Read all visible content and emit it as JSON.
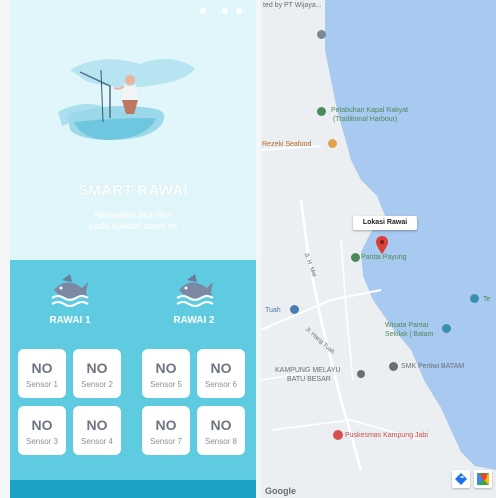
{
  "colors": {
    "left_top_bg": "#e1f6fb",
    "left_bottom_bg": "#5fcbe0",
    "nav_bar": "#1aa3c5",
    "card_bg": "#ffffff",
    "map_land": "#eceff1",
    "map_water": "#a8c9f0"
  },
  "app": {
    "title": "SMART RAWAI",
    "subtitle_line1": "Nikmatilah fitur-fitur",
    "subtitle_line2": "pada aplikasi rawai ini",
    "rawai1": {
      "label": "RAWAI 1",
      "sensors": [
        {
          "value": "NO",
          "label": "Sensor 1"
        },
        {
          "value": "NO",
          "label": "Sensor 2"
        },
        {
          "value": "NO",
          "label": "Sensor 3"
        },
        {
          "value": "NO",
          "label": "Sensor 4"
        }
      ]
    },
    "rawai2": {
      "label": "RAWAI 2",
      "sensors": [
        {
          "value": "NO",
          "label": "Sensor 5"
        },
        {
          "value": "NO",
          "label": "Sensor 6"
        },
        {
          "value": "NO",
          "label": "Sensor 7"
        },
        {
          "value": "NO",
          "label": "Sensor 8"
        }
      ]
    },
    "icons": {
      "hero": "fisherman-boat-illustration",
      "rawai": "fish-wave-icon"
    }
  },
  "map": {
    "labels": {
      "top_attribution": "ted by PT Wijaya...",
      "pelabuhan_line1": "Pelabuhan Kapal Rakyat",
      "pelabuhan_line2": "(Traditional Harbour)",
      "rezeki": "Rezeki Seafood",
      "lokasi": "Lokasi Rawai",
      "pantai_payung": "Pantai Payung",
      "road1": "Jl. H. Mat",
      "tuah": "Tuah",
      "te": "Te",
      "wisata_line1": "Wisata Pantai",
      "wisata_line2": "Sekilak | Batam",
      "smk": "SMK Pertiwi BATAM",
      "kampung_line1": "KAMPUNG MELAYU",
      "kampung_line2": "BATU BESAR",
      "road2": "Jl. Hang Tuah",
      "puskesmas": "Puskesmas Kampung Jabi",
      "google": "Google"
    },
    "icons": {
      "marker": "red-location-pin-icon",
      "directions": "directions-icon",
      "maps_app": "google-maps-icon"
    }
  }
}
